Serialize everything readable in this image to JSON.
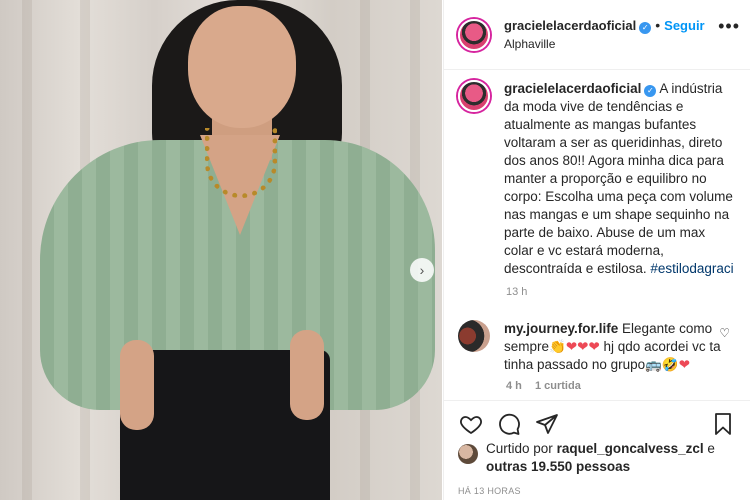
{
  "header": {
    "username": "gracielelacerdaoficial",
    "separator": "•",
    "follow_label": "Seguir",
    "location": "Alphaville",
    "more_icon": "•••"
  },
  "caption": {
    "username": "gracielelacerdaoficial",
    "text": "A indústria da moda vive de tendências e atualmente as mangas bufantes voltaram a ser as queridinhas, direto dos anos 80!! Agora minha dica para manter a proporção e equilibro no corpo: Escolha uma peça com volume nas mangas e um shape sequinho na parte de baixo. Abuse de um max colar e vc estará moderna, descontraída e estilosa.",
    "hashtag": "#estilodagraci",
    "time": "13 h"
  },
  "comment": {
    "username": "my.journey.for.life",
    "text_before": "Elegante como sempre",
    "emojis_1": "👏❤❤❤",
    "text_after": "hj qdo acordei vc ta tinha passado no grupo",
    "emojis_2": "🚌🤣❤",
    "time": "4 h",
    "likes": "1 curtida"
  },
  "likes": {
    "prefix": "Curtido por",
    "user": "raquel_goncalvess_zcl",
    "conj": "e",
    "others": "outras 19.550 pessoas"
  },
  "post_time": "HÁ 13 HORAS",
  "photo_next": "›"
}
